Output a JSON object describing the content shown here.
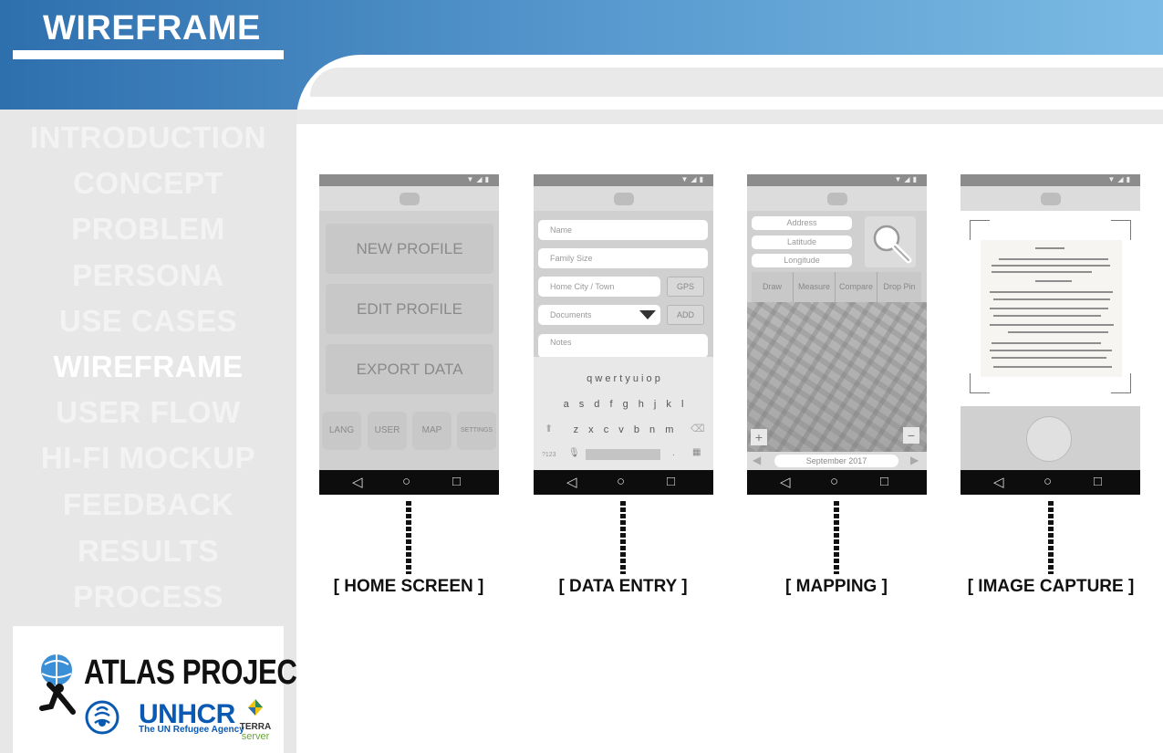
{
  "header": {
    "title": "WIREFRAME"
  },
  "sidebar": {
    "items": [
      {
        "label": "INTRODUCTION"
      },
      {
        "label": "CONCEPT"
      },
      {
        "label": "PROBLEM"
      },
      {
        "label": "PERSONA"
      },
      {
        "label": "USE CASES"
      },
      {
        "label": "WIREFRAME",
        "active": true
      },
      {
        "label": "USER FLOW"
      },
      {
        "label": "HI-FI MOCKUP"
      },
      {
        "label": "FEEDBACK"
      },
      {
        "label": "RESULTS"
      },
      {
        "label": "PROCESS"
      }
    ]
  },
  "logos": {
    "atlas": "ATLAS PROJECT",
    "unhcr": "UNHCR",
    "unhcr_sub": "The UN Refugee Agency",
    "terra": "TERRA",
    "server": "server"
  },
  "phones": {
    "home": {
      "buttons": [
        "NEW PROFILE",
        "EDIT PROFILE",
        "EXPORT DATA"
      ],
      "small": [
        "LANG",
        "USER",
        "MAP",
        "SETTINGS"
      ]
    },
    "entry": {
      "name_placeholder": "Name",
      "family_placeholder": "Family Size",
      "city_placeholder": "Home City / Town",
      "gps_label": "GPS",
      "documents_label": "Documents",
      "add_label": "ADD",
      "notes_placeholder": "Notes",
      "keys_row1": "q w e r t y u i o p",
      "keys_row2": "a s d f g h j k l",
      "keys_row3": "z x c v b n m",
      "key_mode": "?123"
    },
    "mapping": {
      "address_label": "Address",
      "latitude_label": "Latitude",
      "longitude_label": "Longitude",
      "tools": [
        "Draw",
        "Measure",
        "Compare",
        "Drop Pin"
      ],
      "zoom_in": "+",
      "zoom_out": "−",
      "date": "September 2017"
    },
    "capture": {}
  },
  "captions": [
    "[ HOME SCREEN ]",
    "[ DATA ENTRY ]",
    "[ MAPPING ]",
    "[ IMAGE CAPTURE ]"
  ],
  "colors": {
    "header_start": "#2e6fae",
    "header_end": "#7bbbe4",
    "sidebar_bg": "#e7e7e7",
    "phone_bg": "#d0d0d0",
    "nav_bar": "#0d0d0d",
    "unhcr_blue": "#0a5ab4"
  }
}
